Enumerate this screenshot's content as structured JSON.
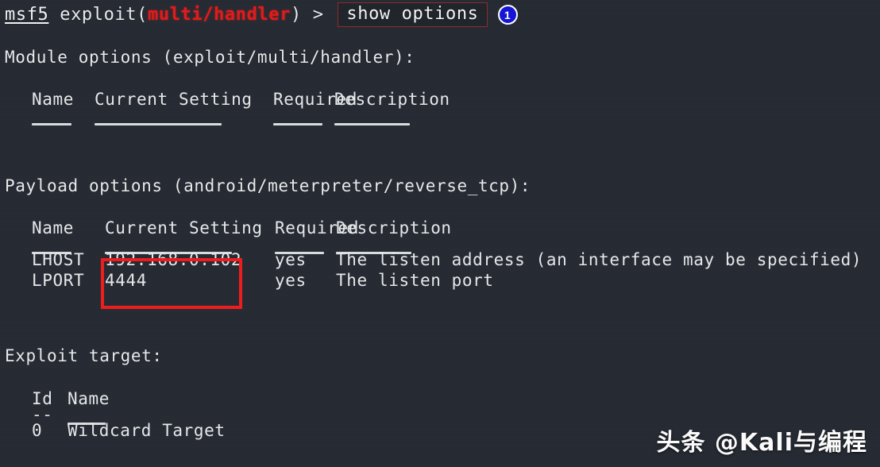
{
  "terminal": {
    "background_color": "#262b33",
    "text_color": "#e9ebed",
    "accent_red": "#ef1c1c",
    "badge_blue": "#1414d8"
  },
  "prompt": {
    "shell_name": "msf5",
    "command_prefix": " exploit(",
    "module_name": "multi/handler",
    "command_suffix": ") > ",
    "typed_command": "show options",
    "step_badge": "1"
  },
  "module_options": {
    "title": "Module options (exploit/multi/handler):",
    "columns": [
      "Name",
      "Current Setting",
      "Required",
      "Description"
    ],
    "rows": []
  },
  "payload_options": {
    "title": "Payload options (android/meterpreter/reverse_tcp):",
    "columns": [
      "Name",
      "Current Setting",
      "Required",
      "Description"
    ],
    "rows": [
      {
        "name": "LHOST",
        "current_setting": "192.168.0.102",
        "required": "yes",
        "description": "The listen address (an interface may be specified)"
      },
      {
        "name": "LPORT",
        "current_setting": "4444",
        "required": "yes",
        "description": "The listen port"
      }
    ]
  },
  "exploit_target": {
    "title": "Exploit target:",
    "columns": [
      "Id",
      "Name"
    ],
    "id_dashes": "--",
    "rows": [
      {
        "id": "0",
        "name": "Wildcard Target"
      }
    ]
  },
  "watermark": {
    "text": "头条 @Kali与编程"
  }
}
